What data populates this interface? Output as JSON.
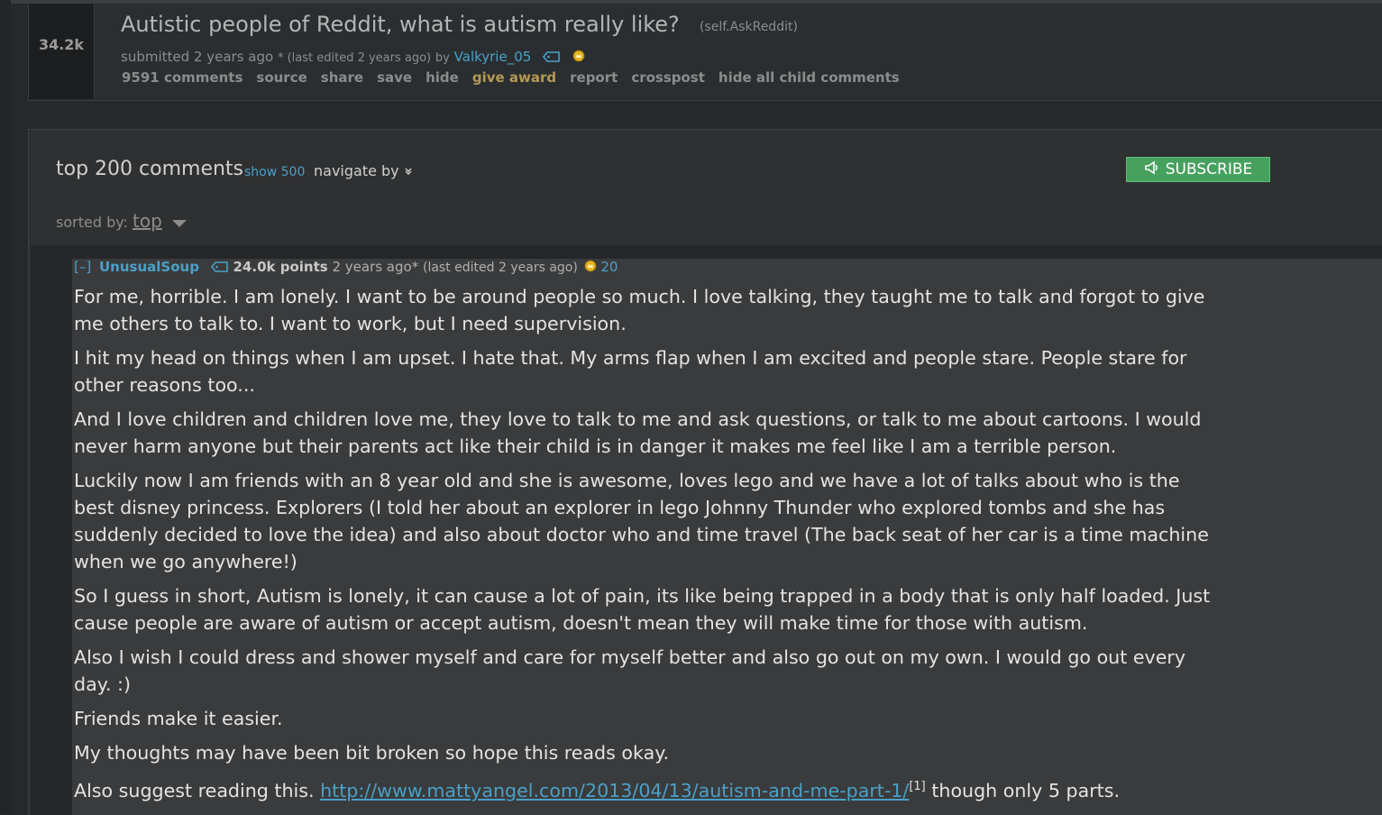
{
  "post": {
    "score": "34.2k",
    "title": "Autistic people of Reddit, what is autism really like?",
    "domain": "(self.AskReddit)",
    "submitted_prefix": "submitted",
    "submitted_time": "2 years ago",
    "edited_text": "* (last edited 2 years ago)",
    "by_text": "by",
    "author": "Valkyrie_05",
    "buttons": {
      "comments": "9591 comments",
      "source": "source",
      "share": "share",
      "save": "save",
      "hide": "hide",
      "give_award": "give award",
      "report": "report",
      "crosspost": "crosspost",
      "hide_children": "hide all child comments"
    }
  },
  "comments_panel": {
    "title": "top 200 comments",
    "show_more": "show 500",
    "navigate_by": "navigate by",
    "subscribe": "SUBSCRIBE",
    "sorted_label": "sorted by:",
    "sort_value": "top"
  },
  "comment": {
    "expand": "[–]",
    "author": "UnusualSoup",
    "points": "24.0k points",
    "time": "2 years ago*",
    "edited": "(last edited 2 years ago)",
    "award_count": "20",
    "paragraphs": [
      "For me, horrible. I am lonely. I want to be around people so much. I love talking, they taught me to talk and forgot to give me others to talk to. I want to work, but I need supervision.",
      "I hit my head on things when I am upset. I hate that. My arms flap when I am excited and people stare. People stare for other reasons too...",
      "And I love children and children love me, they love to talk to me and ask questions, or talk to me about cartoons. I would never harm anyone but their parents act like their child is in danger it makes me feel like I am a terrible person.",
      "Luckily now I am friends with an 8 year old and she is awesome, loves lego and we have a lot of talks about who is the best disney princess. Explorers (I told her about an explorer in lego Johnny Thunder who explored tombs and she has suddenly decided to love the idea) and also about doctor who and time travel (The back seat of her car is a time machine when we go anywhere!)",
      "So I guess in short, Autism is lonely, it can cause a lot of pain, its like being trapped in a body that is only half loaded. Just cause people are aware of autism or accept autism, doesn't mean they will make time for those with autism.",
      "Also I wish I could dress and shower myself and care for myself better and also go out on my own. I would go out every day. :)",
      "Friends make it easier.",
      "My thoughts may have been bit broken so hope this reads okay."
    ],
    "last_para_prefix": "Also suggest reading this.",
    "link": "http://www.mattyangel.com/2013/04/13/autism-and-me-part-1/",
    "link_ref": "[1]",
    "last_para_suffix": "though only 5 parts."
  },
  "colors": {
    "background": "#262829",
    "link": "#4aa0c8",
    "award": "#b39a55",
    "subscribe": "#46a15f"
  }
}
